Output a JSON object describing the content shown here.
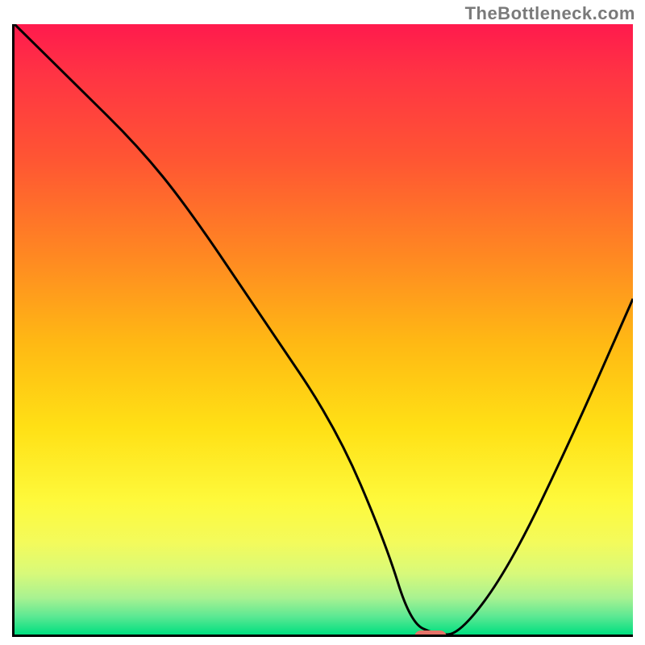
{
  "watermark": "TheBottleneck.com",
  "chart_data": {
    "type": "line",
    "title": "",
    "xlabel": "",
    "ylabel": "",
    "xlim": [
      0,
      100
    ],
    "ylim": [
      0,
      100
    ],
    "background_gradient": {
      "top": "#ff1a4d",
      "middle": "#ffe015",
      "bottom": "#00e080"
    },
    "series": [
      {
        "name": "bottleneck-curve",
        "x": [
          0,
          10,
          20,
          28,
          40,
          52,
          60,
          64,
          68,
          72,
          80,
          90,
          100
        ],
        "y": [
          100,
          90,
          80,
          70,
          52,
          34,
          15,
          2,
          0,
          0,
          11,
          32,
          55
        ]
      }
    ],
    "marker": {
      "name": "optimal-point",
      "x": 67,
      "y": 0,
      "color": "#e57368"
    }
  }
}
